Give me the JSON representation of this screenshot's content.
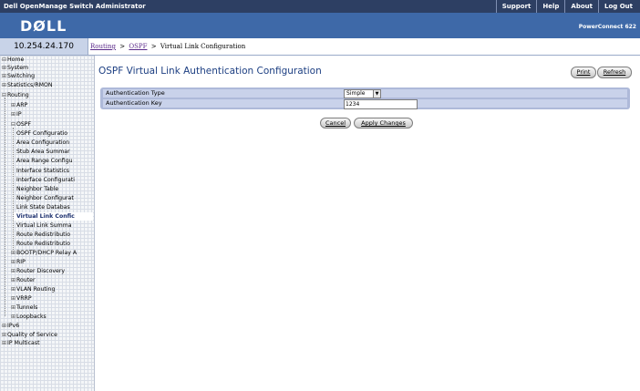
{
  "app": {
    "title": "Dell OpenManage Switch Administrator",
    "links": [
      "Support",
      "Help",
      "About",
      "Log Out"
    ],
    "logo_text": "DØLL",
    "product": "PowerConnect 622",
    "ip": "10.254.24.170"
  },
  "breadcrumb": {
    "items": [
      "Routing",
      "OSPF"
    ],
    "current": "Virtual Link Configuration",
    "separator": ">"
  },
  "sidebar": {
    "items": [
      {
        "label": "Home",
        "toggle": "⊟"
      },
      {
        "label": "System",
        "toggle": "⊞"
      },
      {
        "label": "Switching",
        "toggle": "⊞"
      },
      {
        "label": "Statistics/RMON",
        "toggle": "⊞"
      },
      {
        "label": "Routing",
        "toggle": "⊟"
      },
      {
        "label": "ARP",
        "toggle": "⊞"
      },
      {
        "label": "IP",
        "toggle": "⊞"
      },
      {
        "label": "OSPF",
        "toggle": "⊟"
      },
      {
        "label": "OSPF Configuratio",
        "toggle": ""
      },
      {
        "label": "Area Configuration",
        "toggle": ""
      },
      {
        "label": "Stub Area Summar",
        "toggle": ""
      },
      {
        "label": "Area Range Configu",
        "toggle": ""
      },
      {
        "label": "Interface Statistics",
        "toggle": ""
      },
      {
        "label": "Interface Configurati",
        "toggle": ""
      },
      {
        "label": "Neighbor Table",
        "toggle": ""
      },
      {
        "label": "Neighbor Configurat",
        "toggle": ""
      },
      {
        "label": "Link State Databas",
        "toggle": ""
      },
      {
        "label": "Virtual Link Confic",
        "toggle": ""
      },
      {
        "label": "Virtual Link Summa",
        "toggle": ""
      },
      {
        "label": "Route Redistributio",
        "toggle": ""
      },
      {
        "label": "Route Redistributio",
        "toggle": ""
      },
      {
        "label": "BOOTP/DHCP Relay A",
        "toggle": "⊞"
      },
      {
        "label": "RIP",
        "toggle": "⊞"
      },
      {
        "label": "Router Discovery",
        "toggle": "⊞"
      },
      {
        "label": "Router",
        "toggle": "⊞"
      },
      {
        "label": "VLAN Routing",
        "toggle": "⊞"
      },
      {
        "label": "VRRP",
        "toggle": "⊞"
      },
      {
        "label": "Tunnels",
        "toggle": "⊞"
      },
      {
        "label": "Loopbacks",
        "toggle": "⊞"
      },
      {
        "label": "IPv6",
        "toggle": "⊞"
      },
      {
        "label": "Quality of Service",
        "toggle": "⊞"
      },
      {
        "label": "IP Multicast",
        "toggle": "⊞"
      }
    ],
    "selected_index": 17
  },
  "page": {
    "title": "OSPF Virtual Link Authentication Configuration",
    "print_label": "Print",
    "refresh_label": "Refresh"
  },
  "form": {
    "auth_type_label": "Authentication Type",
    "auth_type_value": "Simple",
    "auth_key_label": "Authentication Key",
    "auth_key_value": "1234"
  },
  "buttons": {
    "cancel": "Cancel",
    "apply": "Apply Changes"
  },
  "colors": {
    "header_bg": "#2d3f63",
    "banner_bg": "#3e69a8",
    "title_color": "#1d3f82",
    "table_bg": "#aeb9d9"
  }
}
